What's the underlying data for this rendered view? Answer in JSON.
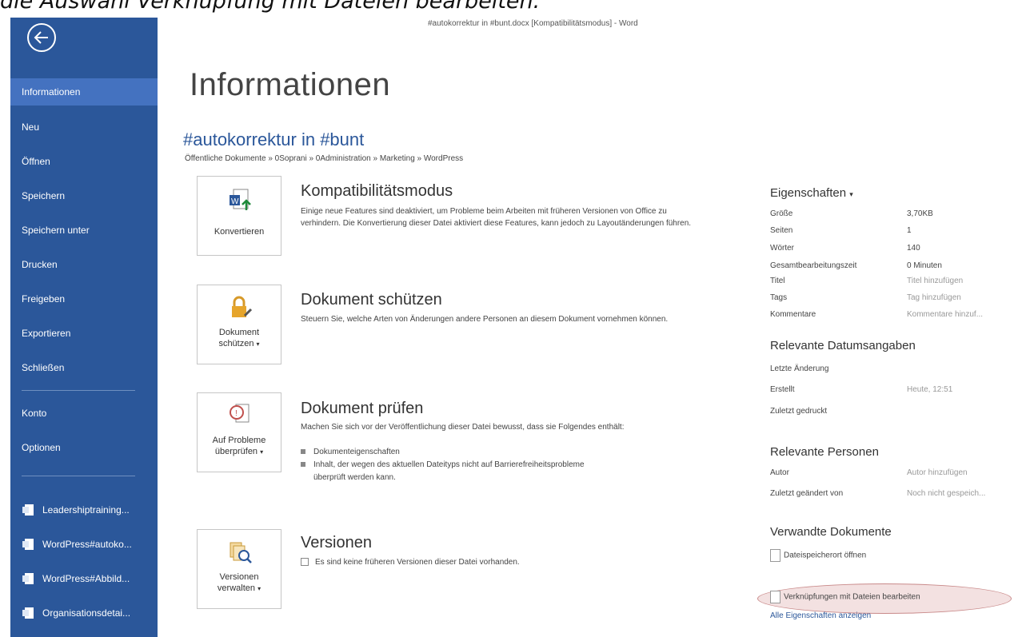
{
  "caption": "die Auswahl Verknüpfung mit Dateien bearbeiten.",
  "window_title": "#autokorrektur in #bunt.docx [Kompatibilitätsmodus] - Word",
  "sidebar": {
    "items": [
      {
        "label": "Informationen"
      },
      {
        "label": "Neu"
      },
      {
        "label": "Öffnen"
      },
      {
        "label": "Speichern"
      },
      {
        "label": "Speichern unter"
      },
      {
        "label": "Drucken"
      },
      {
        "label": "Freigeben"
      },
      {
        "label": "Exportieren"
      },
      {
        "label": "Schließen"
      }
    ],
    "lower_items": [
      {
        "label": "Konto"
      },
      {
        "label": "Optionen"
      }
    ],
    "recent": [
      {
        "label": "Leadershiptraining..."
      },
      {
        "label": "WordPress#autoko..."
      },
      {
        "label": "WordPress#Abbild..."
      },
      {
        "label": "Organisationsdetai..."
      }
    ],
    "active_index": 0
  },
  "main": {
    "title": "Informationen",
    "doc_name": "#autokorrektur in #bunt",
    "doc_path": "Öffentliche Dokumente » 0Soprani » 0Administration » Marketing » WordPress",
    "sections": [
      {
        "tile_label": "Konvertieren",
        "heading": "Kompatibilitätsmodus",
        "text": "Einige neue Features sind deaktiviert, um Probleme beim Arbeiten mit früheren Versionen von Office zu verhindern. Die Konvertierung dieser Datei aktiviert diese Features, kann jedoch zu Layoutänderungen führen."
      },
      {
        "tile_label_1": "Dokument",
        "tile_label_2": "schützen",
        "heading": "Dokument schützen",
        "text": "Steuern Sie, welche Arten von Änderungen andere Personen an diesem Dokument vornehmen können."
      },
      {
        "tile_label_1": "Auf Probleme",
        "tile_label_2": "überprüfen",
        "heading": "Dokument prüfen",
        "text": "Machen Sie sich vor der Veröffentlichung dieser Datei bewusst, dass sie Folgendes enthält:",
        "bullets": [
          "Dokumenteigenschaften",
          "Inhalt, der wegen des aktuellen Dateityps nicht auf Barrierefreiheitsprobleme",
          "überprüft werden kann."
        ]
      },
      {
        "tile_label_1": "Versionen",
        "tile_label_2": "verwalten",
        "heading": "Versionen",
        "text": "Es sind keine früheren Versionen dieser Datei vorhanden."
      }
    ]
  },
  "properties": {
    "heading": "Eigenschaften",
    "rows": [
      {
        "key": "Größe",
        "value": "3,70KB"
      },
      {
        "key": "Seiten",
        "value": "1"
      },
      {
        "key": "Wörter",
        "value": "140"
      },
      {
        "key": "Gesamtbearbeitungszeit",
        "value": "0 Minuten"
      },
      {
        "key": "Titel",
        "value": "Titel hinzufügen"
      },
      {
        "key": "Tags",
        "value": "Tag hinzufügen"
      },
      {
        "key": "Kommentare",
        "value": "Kommentare hinzuf..."
      }
    ],
    "dates_heading": "Relevante Datumsangaben",
    "dates": [
      {
        "key": "Letzte Änderung",
        "value": ""
      },
      {
        "key": "Erstellt",
        "value": "Heute, 12:51"
      },
      {
        "key": "Zuletzt gedruckt",
        "value": ""
      }
    ],
    "people_heading": "Relevante Personen",
    "people": [
      {
        "key": "Autor",
        "value": "Autor hinzufügen"
      },
      {
        "key": "Zuletzt geändert von",
        "value": "Noch nicht gespeich..."
      }
    ],
    "related_heading": "Verwandte Dokumente",
    "related": [
      {
        "label": "Dateispeicherort öffnen"
      },
      {
        "label": "Verknüpfungen mit Dateien bearbeiten"
      }
    ],
    "all_props_link": "Alle Eigenschaften anzeigen"
  },
  "colors": {
    "sidebar": "#2b579a",
    "accent": "#2b579a",
    "highlight": "#c98a8a"
  }
}
